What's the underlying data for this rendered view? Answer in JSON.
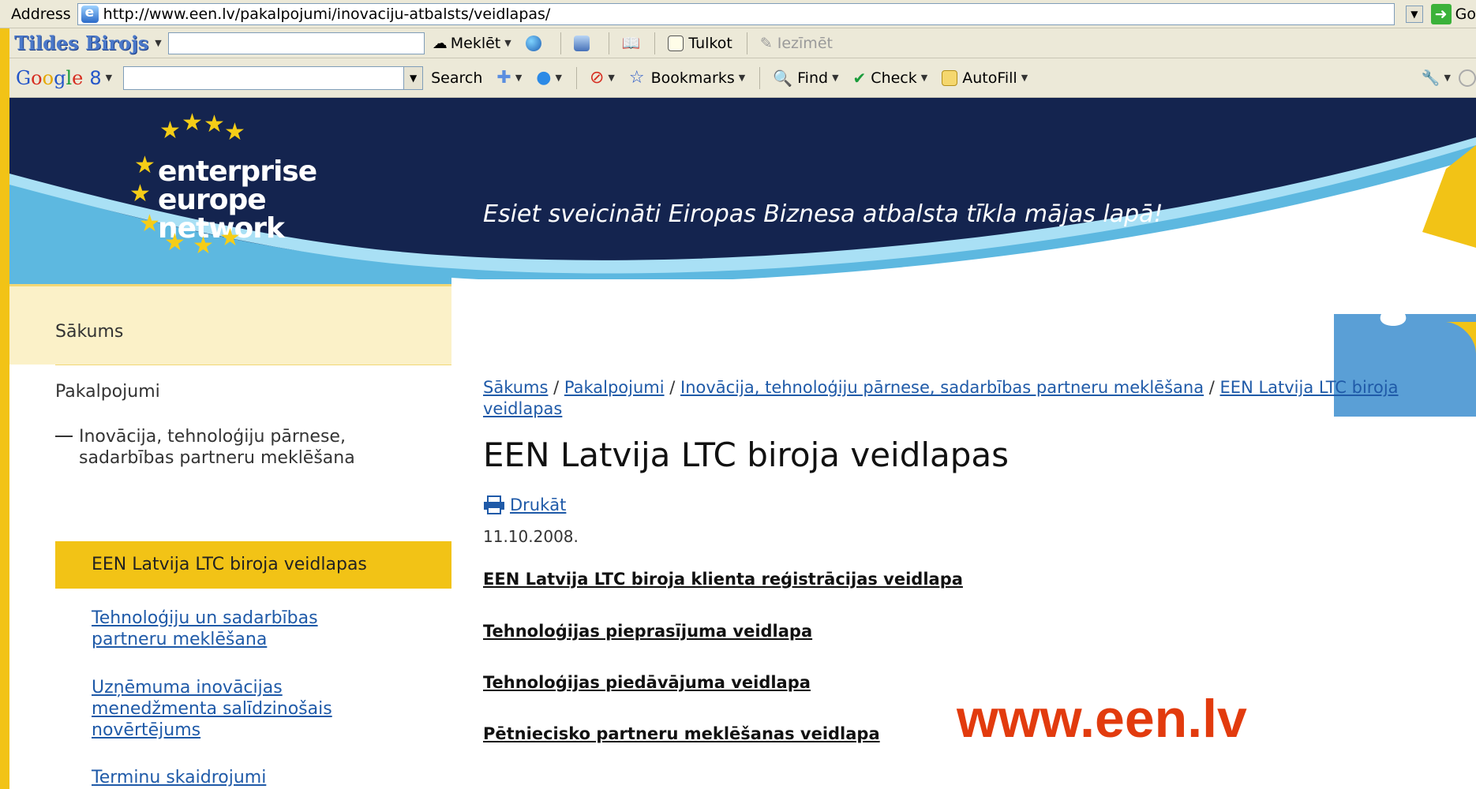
{
  "browser": {
    "address_label": "Address",
    "url": "http://www.een.lv/pakalpojumi/inovaciju-atbalsts/veidlapas/",
    "go_label": "Go",
    "tilde_logo": "Tildes Birojs",
    "tilde_search_label": "Meklēt",
    "tilde_translate_label": "Tulkot",
    "tilde_mark_label": "Iezīmēt",
    "google_logo_chars": [
      "G",
      "o",
      "o",
      "g",
      "l",
      "e"
    ],
    "google_extra": "8",
    "search_label": "Search",
    "bookmarks_label": "Bookmarks",
    "find_label": "Find",
    "check_label": "Check",
    "autofill_label": "AutoFill"
  },
  "header": {
    "logo_lines": [
      "enterprise",
      "europe",
      "network"
    ],
    "tagline": "Esiet sveicināti Eiropas Biznesa atbalsta tīkla mājas lapā!",
    "colors": {
      "navy": "#14244f",
      "teal": "#6ec6e8",
      "gold": "#f2c316"
    }
  },
  "nav": {
    "home": "Sākums",
    "services": "Pakalpojumi",
    "innovation": "Inovācija, tehnoloģiju pārnese, sadarbības partneru meklēšana",
    "active": "EEN Latvija LTC biroja veidlapas",
    "links": [
      "Tehnoloģiju un sadarbības partneru meklēšana",
      "Uzņēmuma inovācijas menedžmenta salīdzinošais novērtējums",
      "Terminu skaidrojumi"
    ]
  },
  "main": {
    "breadcrumb": [
      "Sākums",
      "Pakalpojumi",
      "Inovācija, tehnoloģiju pārnese, sadarbības partneru meklēšana",
      "EEN Latvija LTC biroja veidlapas"
    ],
    "title": "EEN Latvija LTC biroja veidlapas",
    "print_label": "Drukāt",
    "date": "11.10.2008.",
    "docs": [
      "EEN Latvija LTC biroja klienta reģistrācijas veidlapa",
      "Tehnoloģijas pieprasījuma veidlapa",
      "Tehnoloģijas piedāvājuma veidlapa",
      "Pētniecisko partneru meklēšanas veidlapa"
    ]
  },
  "watermark": "www.een.lv"
}
